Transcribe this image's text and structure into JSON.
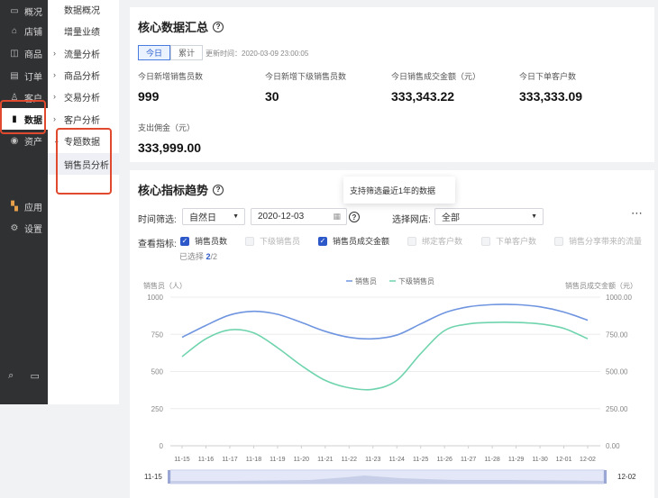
{
  "sidebar": {
    "items": [
      {
        "icon": "monitor-icon",
        "label": "概况"
      },
      {
        "icon": "store-icon",
        "label": "店铺"
      },
      {
        "icon": "bag-icon",
        "label": "商品"
      },
      {
        "icon": "order-icon",
        "label": "订单"
      },
      {
        "icon": "user-icon",
        "label": "客户"
      },
      {
        "icon": "bar-chart-icon",
        "label": "数据"
      },
      {
        "icon": "asset-icon",
        "label": "资产"
      },
      {
        "icon": "apps-icon",
        "label": "应用"
      },
      {
        "icon": "gear-icon",
        "label": "设置"
      }
    ],
    "active_index": 5
  },
  "submenu": {
    "items": [
      {
        "label": "数据概况",
        "arrow": ""
      },
      {
        "label": "增量业绩",
        "arrow": ""
      },
      {
        "label": "流量分析",
        "arrow": "›"
      },
      {
        "label": "商品分析",
        "arrow": "›"
      },
      {
        "label": "交易分析",
        "arrow": "›"
      },
      {
        "label": "客户分析",
        "arrow": "›"
      },
      {
        "label": "专题数据",
        "arrow": "⌄"
      },
      {
        "label": "销售员分析",
        "arrow": ""
      }
    ]
  },
  "summary": {
    "title": "核心数据汇总",
    "tab_today": "今日",
    "tab_total": "累计",
    "update_time": "更新时间：2020-03-09 23:00:05",
    "metrics": [
      {
        "label": "今日新增销售员数",
        "value": "999"
      },
      {
        "label": "今日新增下级销售员数",
        "value": "30"
      },
      {
        "label": "今日销售成交金额（元）",
        "value": "333,343.22"
      },
      {
        "label": "今日下单客户数",
        "value": "333,333.09"
      },
      {
        "label": "支出佣金（元）",
        "value": "333,999.00"
      }
    ]
  },
  "trend": {
    "title": "核心指标趋势",
    "tooltip": "支持筛选最近1年的数据",
    "time_filter_label": "时间筛选:",
    "period_value": "自然日",
    "date_value": "2020-12-03",
    "store_label": "选择网店:",
    "store_value": "全部",
    "metrics_label": "查看指标:",
    "metric_options": [
      {
        "label": "销售员数",
        "checked": true,
        "disabled": false
      },
      {
        "label": "下级销售员",
        "checked": false,
        "disabled": true
      },
      {
        "label": "销售员成交金额",
        "checked": true,
        "disabled": false
      },
      {
        "label": "绑定客户数",
        "checked": false,
        "disabled": true
      },
      {
        "label": "下单客户数",
        "checked": false,
        "disabled": true
      },
      {
        "label": "销售分享带来的流量",
        "checked": false,
        "disabled": true
      }
    ],
    "selected_prefix": "已选择",
    "selected_count": "2",
    "selected_total": "/2",
    "more_icon": "ellipsis-icon"
  },
  "chart_data": {
    "type": "line",
    "legend_position": "top-center",
    "ylabel_left": "销售员（人）",
    "ylabel_right": "销售员成交金额（元）",
    "yticks_left": [
      "1000",
      "750",
      "500",
      "250",
      "0"
    ],
    "yticks_right": [
      "1000.00",
      "750.00",
      "500.00",
      "250.00",
      "0.00"
    ],
    "ylim": [
      0,
      1000
    ],
    "x": [
      "11-15",
      "11-16",
      "11-17",
      "11-18",
      "11-19",
      "11-20",
      "11-21",
      "11-22",
      "11-23",
      "11-24",
      "11-25",
      "11-26",
      "11-27",
      "11-28",
      "11-29",
      "11-30",
      "12-01",
      "12-02"
    ],
    "series": [
      {
        "name": "销售员",
        "color": "#6f95e0",
        "values": [
          730,
          810,
          880,
          905,
          885,
          830,
          770,
          730,
          720,
          745,
          820,
          895,
          935,
          950,
          950,
          935,
          900,
          845
        ]
      },
      {
        "name": "下级销售员",
        "color": "#6fd4ad",
        "values": [
          600,
          720,
          780,
          760,
          660,
          540,
          440,
          390,
          380,
          440,
          620,
          775,
          820,
          830,
          830,
          820,
          790,
          720
        ]
      }
    ],
    "slider_start": "11-15",
    "slider_end": "12-02"
  }
}
